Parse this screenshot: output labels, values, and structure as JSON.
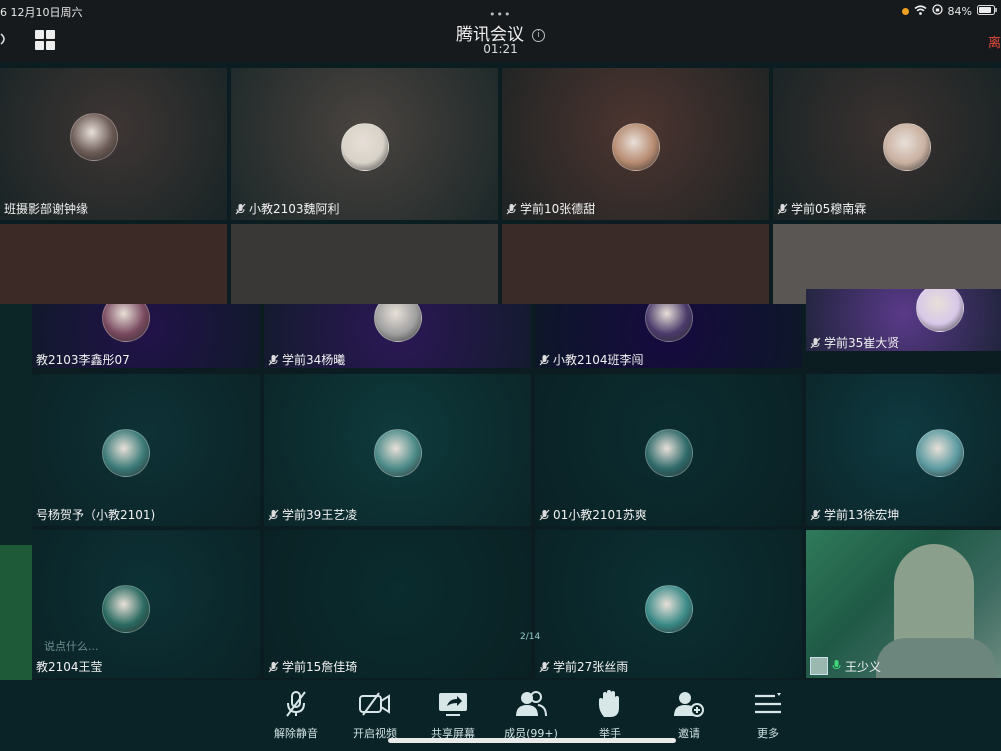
{
  "status_bar": {
    "left": "6   12月10日周六",
    "battery": "84%"
  },
  "header": {
    "title": "腾讯会议",
    "timer": "01:21",
    "grabber": "•••",
    "info_icon": "i",
    "leave_label": "离"
  },
  "tiles": [
    {
      "name": "班摄影部谢钟缘",
      "muted": false,
      "avatar_color": "#6b5a55"
    },
    {
      "name": "小教2103魏阿利",
      "muted": true,
      "avatar_color": "#d8d2c8"
    },
    {
      "name": "学前10张德甜",
      "muted": true,
      "avatar_color": "#b68a70"
    },
    {
      "name": "学前05穆南霖",
      "muted": true,
      "avatar_color": "#c9b0a0"
    },
    {
      "name": "教2103李鑫彤07",
      "muted": false,
      "avatar_color": "#7a4a60"
    },
    {
      "name": "学前34杨曦",
      "muted": true,
      "avatar_color": "#a0a0a0"
    },
    {
      "name": "小教2104班李闯",
      "muted": true,
      "avatar_color": "#4a3a6a"
    },
    {
      "name": "学前35崔大贤",
      "muted": true,
      "avatar_color": "#d8c8e8"
    },
    {
      "name": "号杨贺予（小教2101)",
      "muted": false,
      "avatar_color": "#3a7a78"
    },
    {
      "name": "学前39王艺凌",
      "muted": true,
      "avatar_color": "#4a8a88"
    },
    {
      "name": "01小教2101苏爽",
      "muted": true,
      "avatar_color": "#2f6a6a"
    },
    {
      "name": "学前13徐宏坤",
      "muted": true,
      "avatar_color": "#5a9aa0"
    },
    {
      "name": "教2104王莹",
      "muted": false,
      "avatar_color": "#2a6a60"
    },
    {
      "name": "学前15詹佳琦",
      "muted": true,
      "avatar_color": ""
    },
    {
      "name": "学前27张丝雨",
      "muted": true,
      "avatar_color": "#3a8a88"
    },
    {
      "name": "王少义",
      "muted": false,
      "avatar_color": ""
    }
  ],
  "chat_hint": "说点什么...",
  "page_indicator": "2/14",
  "toolbar": [
    {
      "label": "解除静音",
      "icon": "mic-off-icon"
    },
    {
      "label": "开启视频",
      "icon": "camera-off-icon"
    },
    {
      "label": "共享屏幕",
      "icon": "share-screen-icon"
    },
    {
      "label": "成员(99+)",
      "icon": "members-icon"
    },
    {
      "label": "举手",
      "icon": "raise-hand-icon"
    },
    {
      "label": "邀请",
      "icon": "invite-icon"
    },
    {
      "label": "更多",
      "icon": "more-icon"
    }
  ],
  "colors": {
    "leave": "#e04a3a",
    "panel": "#161a1d",
    "dock": "#0a2327",
    "teal_overlay": "#0e3a3e",
    "purple_overlay": "#2a1a50"
  }
}
